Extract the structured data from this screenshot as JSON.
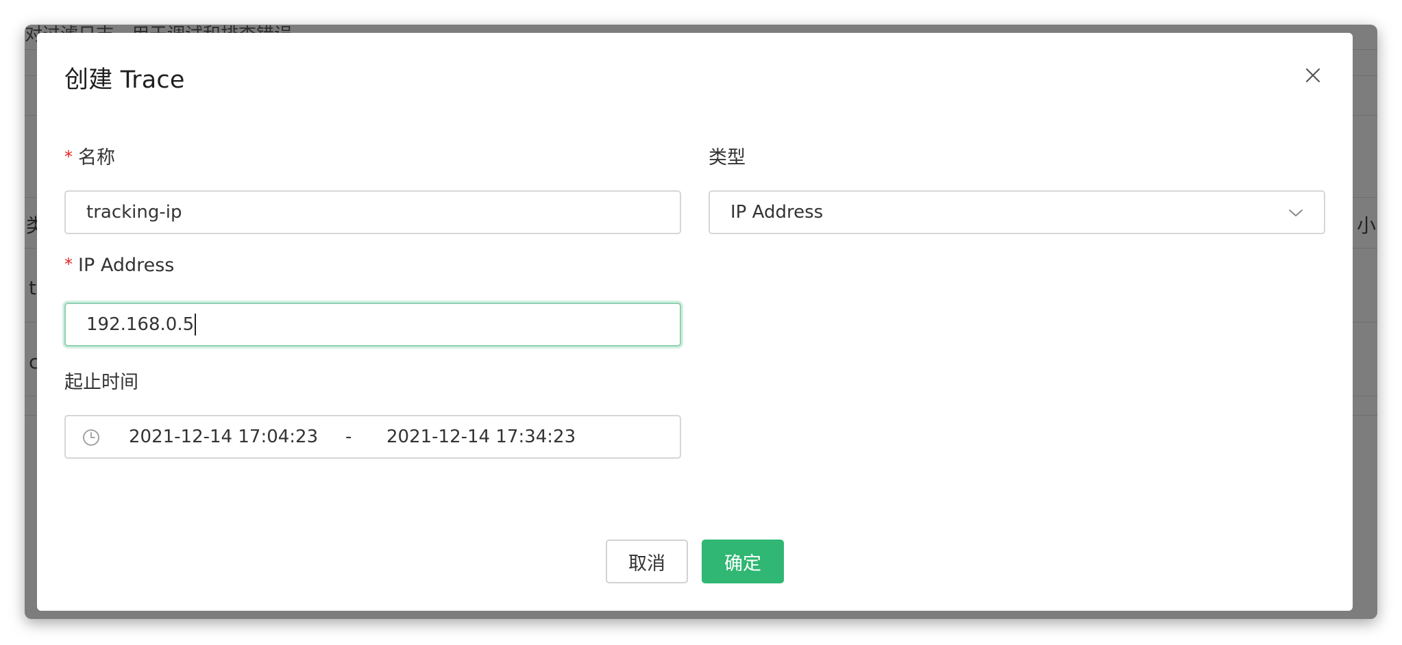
{
  "background": {
    "top_text": "对过滤日志，用于调试和排查错误",
    "left_fragments": [
      "类",
      "t",
      "c"
    ],
    "right_fragment": "小"
  },
  "modal": {
    "title": "创建 Trace",
    "close_icon": "close-icon",
    "fields": {
      "name": {
        "label": "名称",
        "required_mark": "*",
        "value": "tracking-ip"
      },
      "type": {
        "label": "类型",
        "selected": "IP Address",
        "icon": "chevron-down-icon"
      },
      "ip": {
        "label": "IP Address",
        "required_mark": "*",
        "value": "192.168.0.5"
      },
      "time_range": {
        "label": "起止时间",
        "icon": "clock-icon",
        "start": "2021-12-14 17:04:23",
        "separator": "-",
        "end": "2021-12-14 17:34:23"
      }
    },
    "buttons": {
      "cancel": "取消",
      "ok": "确定"
    }
  },
  "colors": {
    "primary": "#2fb773",
    "required": "#e02424",
    "focus_border": "#8ed0b1",
    "overlay": "#7d7d7d"
  }
}
